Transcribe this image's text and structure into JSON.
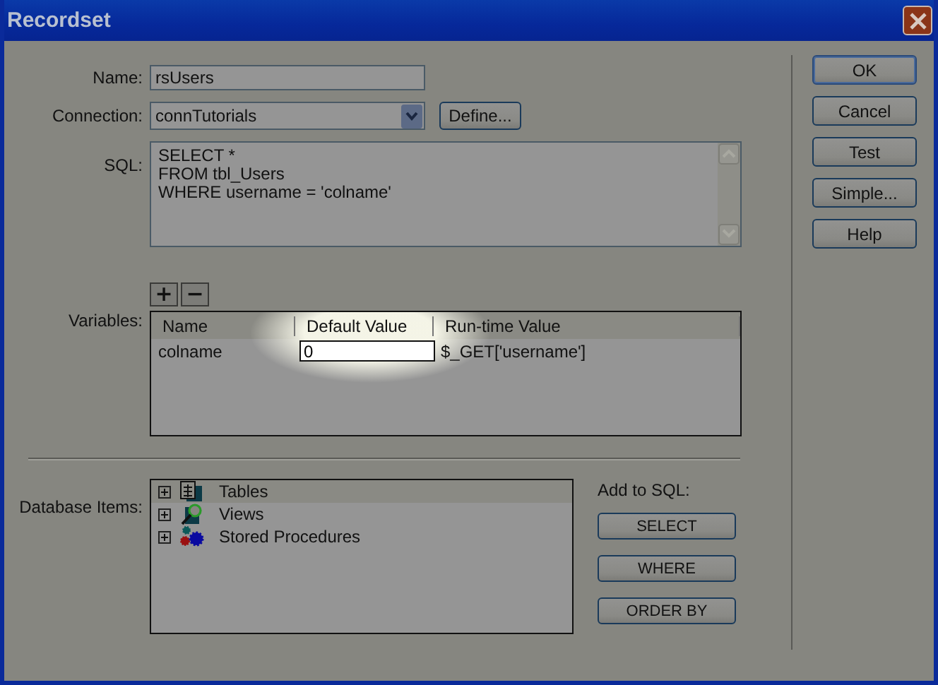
{
  "window": {
    "title": "Recordset"
  },
  "name_field": {
    "label": "Name:",
    "value": "rsUsers"
  },
  "connection": {
    "label": "Connection:",
    "value": "connTutorials",
    "define_button": "Define..."
  },
  "sql": {
    "label": "SQL:",
    "value": "SELECT *\nFROM tbl_Users\nWHERE username = 'colname'"
  },
  "variables": {
    "label": "Variables:",
    "add_button": "+",
    "remove_button": "−",
    "columns": [
      "Name",
      "Default Value",
      "Run-time Value"
    ],
    "rows": [
      {
        "name": "colname",
        "default_value": "0",
        "runtime_value": "$_GET['username']",
        "highlighted": true
      }
    ]
  },
  "database_items": {
    "label": "Database Items:",
    "items": [
      {
        "label": "Tables",
        "kind": "tables",
        "expanded": false,
        "selected": true
      },
      {
        "label": "Views",
        "kind": "views",
        "expanded": false,
        "selected": false
      },
      {
        "label": "Stored Procedures",
        "kind": "procedures",
        "expanded": false,
        "selected": false
      }
    ]
  },
  "add_to_sql": {
    "label": "Add to SQL:",
    "buttons": [
      "SELECT",
      "WHERE",
      "ORDER BY"
    ]
  },
  "buttons": [
    {
      "label": "OK",
      "default": true
    },
    {
      "label": "Cancel",
      "default": false
    },
    {
      "label": "Test",
      "default": false
    },
    {
      "label": "Simple...",
      "default": false
    },
    {
      "label": "Help",
      "default": false
    }
  ]
}
